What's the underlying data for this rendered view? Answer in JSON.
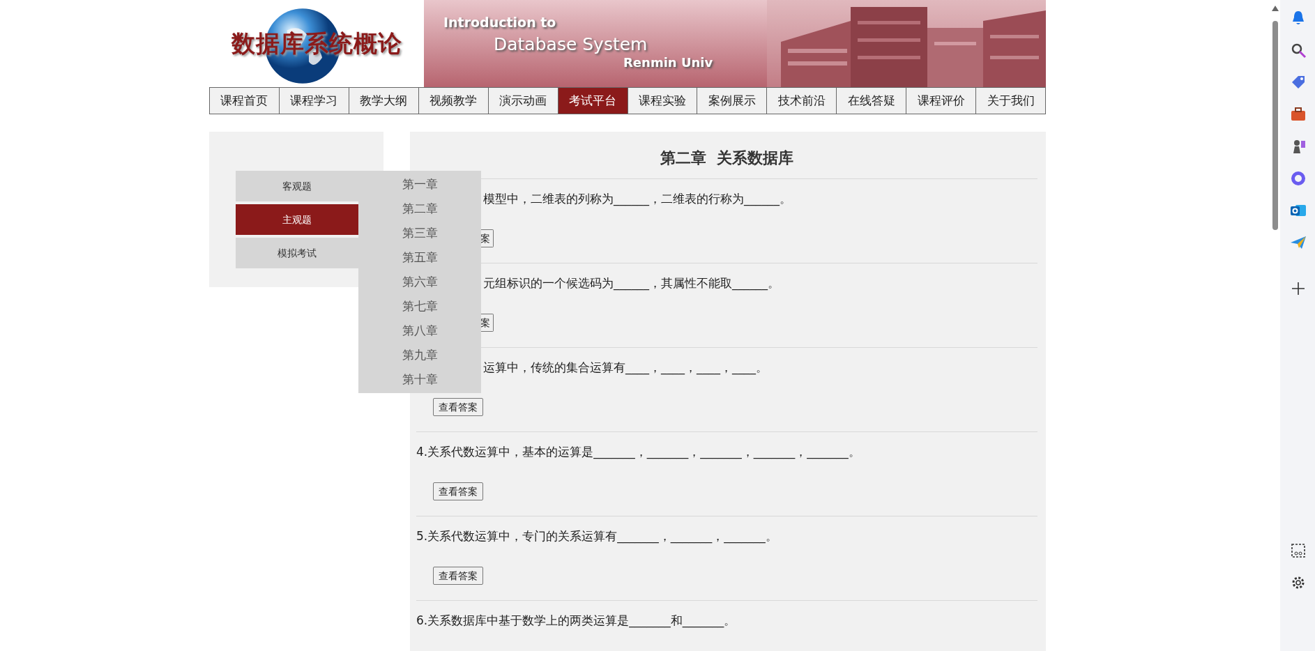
{
  "banner": {
    "logo": "数据库系统概论",
    "line_1": "Introduction to",
    "line_2": "Database System",
    "line_3": "Renmin Univ"
  },
  "nav": [
    {
      "label": "课程首页",
      "selected": false
    },
    {
      "label": "课程学习",
      "selected": false
    },
    {
      "label": "教学大纲",
      "selected": false
    },
    {
      "label": "视频教学",
      "selected": false
    },
    {
      "label": "演示动画",
      "selected": false
    },
    {
      "label": "考试平台",
      "selected": true
    },
    {
      "label": "课程实验",
      "selected": false
    },
    {
      "label": "案例展示",
      "selected": false
    },
    {
      "label": "技术前沿",
      "selected": false
    },
    {
      "label": "在线答疑",
      "selected": false
    },
    {
      "label": "课程评价",
      "selected": false
    },
    {
      "label": "关于我们",
      "selected": false
    }
  ],
  "side_menu": [
    {
      "label": "客观题",
      "selected": false
    },
    {
      "label": "主观题",
      "selected": true
    },
    {
      "label": "模拟考试",
      "selected": false
    }
  ],
  "chapter_menu": [
    "第一章",
    "第二章",
    "第三章",
    "第五章",
    "第六章",
    "第七章",
    "第八章",
    "第九章",
    "第十章"
  ],
  "content": {
    "title": "第二章  关系数据库",
    "questions": [
      {
        "text": "模型中，二维表的列称为______，二维表的行称为______。",
        "covered": true,
        "button": "案"
      },
      {
        "text": "元组标识的一个候选码为______，其属性不能取______。",
        "covered": true,
        "button": "案"
      },
      {
        "text": "运算中，传统的集合运算有____，____，____，____。",
        "covered": true,
        "button": "查看答案"
      },
      {
        "text": "4.关系代数运算中，基本的运算是_______，_______，_______，_______，_______。",
        "covered": false,
        "button": "查看答案"
      },
      {
        "text": "5.关系代数运算中，专门的关系运算有_______，_______，_______。",
        "covered": false,
        "button": "查看答案"
      },
      {
        "text": "6.关系数据库中基于数学上的两类运算是_______和_______。",
        "covered": false
      }
    ]
  }
}
